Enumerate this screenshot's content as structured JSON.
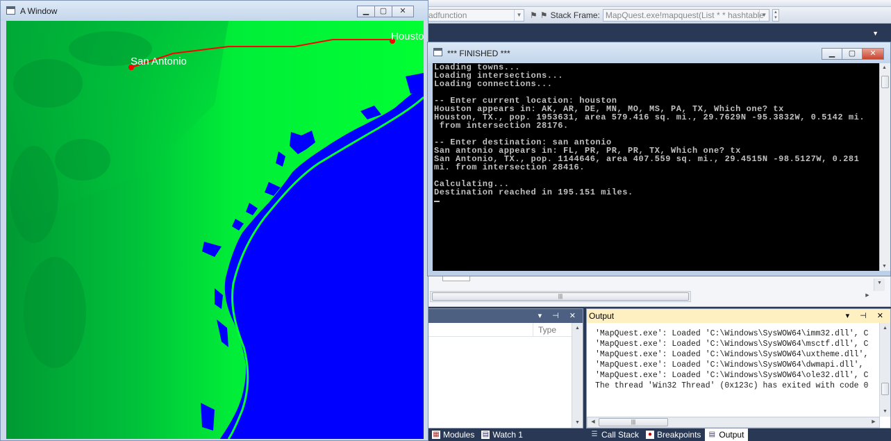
{
  "ide": {
    "toolbar_combo1": "adfunction",
    "stack_frame_label": "Stack Frame:",
    "stack_frame_value": "MapQuest.exe!mapquest(List * * hashtable",
    "locals_column_type": "Type",
    "output_panel_title": "Output",
    "output_lines": [
      "'MapQuest.exe': Loaded 'C:\\Windows\\SysWOW64\\imm32.dll', C",
      "'MapQuest.exe': Loaded 'C:\\Windows\\SysWOW64\\msctf.dll', C",
      "'MapQuest.exe': Loaded 'C:\\Windows\\SysWOW64\\uxtheme.dll',",
      "'MapQuest.exe': Loaded 'C:\\Windows\\SysWOW64\\dwmapi.dll',",
      "'MapQuest.exe': Loaded 'C:\\Windows\\SysWOW64\\ole32.dll', C",
      "The thread 'Win32 Thread' (0x123c) has exited with code 0"
    ],
    "tabs_left": [
      {
        "label": "Modules",
        "icon": "modules-icon"
      },
      {
        "label": "Watch 1",
        "icon": "watch-icon"
      }
    ],
    "tabs_right": [
      {
        "label": "Call Stack",
        "icon": "call-stack-icon"
      },
      {
        "label": "Breakpoints",
        "icon": "breakpoints-icon"
      },
      {
        "label": "Output",
        "icon": "output-icon"
      }
    ]
  },
  "map_window": {
    "title": "A Window",
    "cities": [
      {
        "name": "San Antonio"
      },
      {
        "name": "Houston"
      }
    ],
    "colors": {
      "land": "#00ff33",
      "water": "#0000ff",
      "route": "#ff0000"
    }
  },
  "console_window": {
    "title": "*** FINISHED ***",
    "lines": [
      "Loading towns...",
      "Loading intersections...",
      "Loading connections...",
      "",
      "-- Enter current location: houston",
      "Houston appears in: AK, AR, DE, MN, MO, MS, PA, TX, Which one? tx",
      "Houston, TX., pop. 1953631, area 579.416 sq. mi., 29.7629N -95.3832W, 0.5142 mi.",
      " from intersection 28176.",
      "",
      "-- Enter destination: san antonio",
      "San antonio appears in: FL, PR, PR, PR, TX, Which one? tx",
      "San Antonio, TX., pop. 1144646, area 407.559 sq. mi., 29.4515N -98.5127W, 0.281",
      "mi. from intersection 28416.",
      "",
      "Calculating...",
      "Destination reached in 195.151 miles."
    ]
  }
}
